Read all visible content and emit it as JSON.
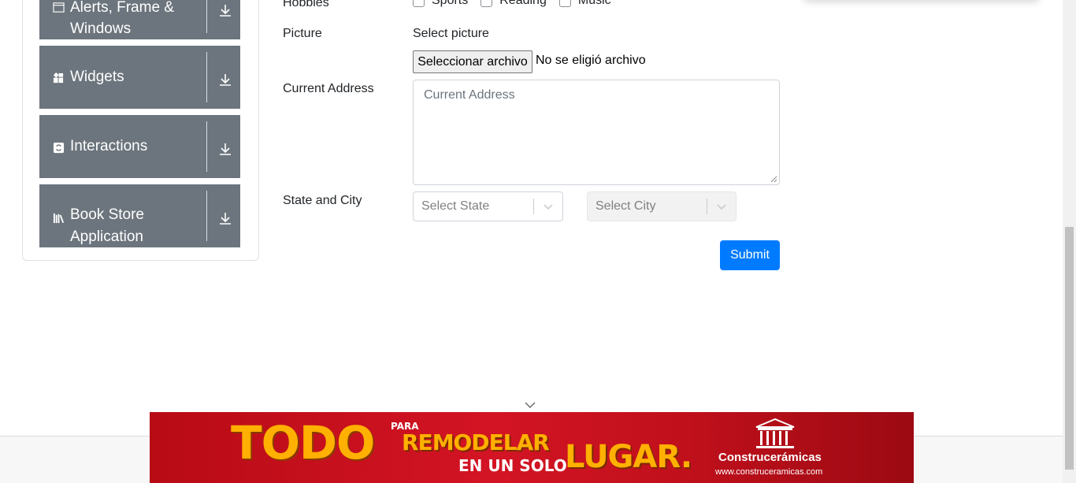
{
  "sidebar": {
    "groups": [
      {
        "label_line1": "Alerts, Frame &",
        "label_line2": "Windows",
        "icon": "window-icon"
      },
      {
        "label_line1": "Widgets",
        "label_line2": "",
        "icon": "widgets-icon"
      },
      {
        "label_line1": "Interactions",
        "label_line2": "",
        "icon": "interactions-icon"
      },
      {
        "label_line1": "Book Store",
        "label_line2": "Application",
        "icon": "bookstore-icon"
      }
    ]
  },
  "form": {
    "hobbies_label": "Hobbies",
    "hobbies": [
      "Sports",
      "Reading",
      "Music"
    ],
    "picture_label": "Picture",
    "picture_caption": "Select picture",
    "file_button": "Seleccionar archivo",
    "file_status": "No se eligió archivo",
    "address_label": "Current Address",
    "address_placeholder": "Current Address",
    "state_city_label": "State and City",
    "state_placeholder": "Select State",
    "city_placeholder": "Select City",
    "submit_label": "Submit"
  },
  "ad": {
    "word1": "TODO",
    "para": "PARA",
    "word2": "REMODELAR",
    "word3": "EN UN SOLO",
    "word4": "LUGAR.",
    "brand": "Construcerámicas",
    "url": "www.construceramicas.com"
  },
  "colors": {
    "sidebar_group": "#6c757d",
    "submit": "#007bff",
    "ad_red": "#d31424",
    "ad_gold": "#ffb000"
  }
}
